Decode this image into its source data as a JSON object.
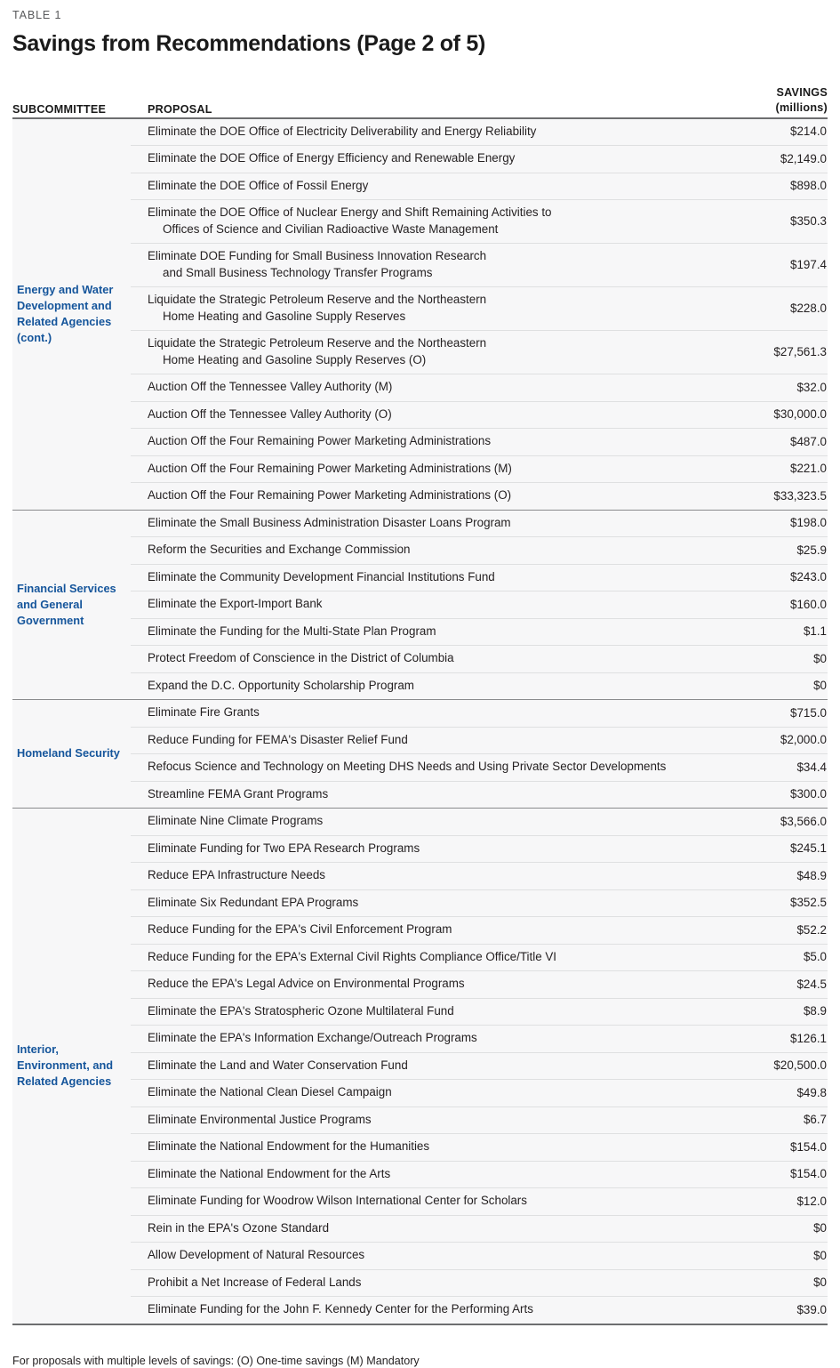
{
  "header": {
    "table_label": "TABLE 1",
    "title": "Savings from Recommendations (Page 2 of 5)"
  },
  "columns": {
    "subcommittee": "SUBCOMMITTEE",
    "proposal": "PROPOSAL",
    "savings_line1": "SAVINGS",
    "savings_line2": "(millions)"
  },
  "colors": {
    "subcommittee_blue": "#15559b",
    "rule_dark": "#6d6e70",
    "rule_light": "#dfe0e1",
    "table_background": "#f7f7f8"
  },
  "footnote": "For proposals with multiple levels of savings:  (O) One-time savings  (M) Mandatory",
  "sections": [
    {
      "subcommittee": "Energy and Water Development and Related Agencies (cont.)",
      "rows": [
        {
          "line1": "Eliminate the DOE Office of Electricity Deliverability and Energy Reliability",
          "line2": "",
          "savings": "$214.0"
        },
        {
          "line1": "Eliminate the DOE Office of Energy Efficiency and Renewable Energy",
          "line2": "",
          "savings": "$2,149.0"
        },
        {
          "line1": "Eliminate the DOE Office of Fossil Energy",
          "line2": "",
          "savings": "$898.0"
        },
        {
          "line1": "Eliminate the DOE Office of Nuclear Energy and Shift Remaining Activities to",
          "line2": "Offices of Science and Civilian Radioactive Waste Management",
          "savings": "$350.3"
        },
        {
          "line1": "Eliminate DOE Funding for Small Business Innovation Research",
          "line2": "and Small Business Technology Transfer Programs",
          "savings": "$197.4"
        },
        {
          "line1": "Liquidate the Strategic Petroleum Reserve and the Northeastern",
          "line2": "Home Heating and Gasoline Supply Reserves",
          "savings": "$228.0"
        },
        {
          "line1": "Liquidate the Strategic Petroleum Reserve and the Northeastern",
          "line2": "Home Heating and Gasoline Supply Reserves (O)",
          "savings": "$27,561.3"
        },
        {
          "line1": "Auction Off the Tennessee Valley Authority (M)",
          "line2": "",
          "savings": "$32.0"
        },
        {
          "line1": "Auction Off the Tennessee Valley Authority (O)",
          "line2": "",
          "savings": "$30,000.0"
        },
        {
          "line1": "Auction Off the Four Remaining Power Marketing Administrations",
          "line2": "",
          "savings": "$487.0"
        },
        {
          "line1": "Auction Off the Four Remaining Power Marketing Administrations (M)",
          "line2": "",
          "savings": "$221.0"
        },
        {
          "line1": "Auction Off the Four Remaining Power Marketing Administrations (O)",
          "line2": "",
          "savings": "$33,323.5"
        }
      ]
    },
    {
      "subcommittee": "Financial Services and General Government",
      "rows": [
        {
          "line1": "Eliminate the Small Business Administration Disaster Loans Program",
          "line2": "",
          "savings": "$198.0"
        },
        {
          "line1": "Reform the Securities and Exchange Commission",
          "line2": "",
          "savings": "$25.9"
        },
        {
          "line1": "Eliminate the Community Development Financial Institutions Fund",
          "line2": "",
          "savings": "$243.0"
        },
        {
          "line1": "Eliminate the Export-Import Bank",
          "line2": "",
          "savings": "$160.0"
        },
        {
          "line1": "Eliminate the Funding for the Multi-State Plan Program",
          "line2": "",
          "savings": "$1.1"
        },
        {
          "line1": "Protect Freedom of Conscience in the District of Columbia",
          "line2": "",
          "savings": "$0"
        },
        {
          "line1": "Expand the D.C. Opportunity Scholarship Program",
          "line2": "",
          "savings": "$0"
        }
      ]
    },
    {
      "subcommittee": "Homeland Security",
      "rows": [
        {
          "line1": "Eliminate Fire Grants",
          "line2": "",
          "savings": "$715.0"
        },
        {
          "line1": "Reduce Funding for FEMA's Disaster Relief Fund",
          "line2": "",
          "savings": "$2,000.0"
        },
        {
          "line1": "Refocus Science and Technology on Meeting DHS Needs and Using Private Sector Developments",
          "line2": "",
          "savings": "$34.4"
        },
        {
          "line1": "Streamline FEMA Grant Programs",
          "line2": "",
          "savings": "$300.0"
        }
      ]
    },
    {
      "subcommittee": "Interior, Environment, and Related Agencies",
      "rows": [
        {
          "line1": "Eliminate Nine Climate Programs",
          "line2": "",
          "savings": "$3,566.0"
        },
        {
          "line1": "Eliminate Funding for Two EPA Research Programs",
          "line2": "",
          "savings": "$245.1"
        },
        {
          "line1": "Reduce EPA Infrastructure Needs",
          "line2": "",
          "savings": "$48.9"
        },
        {
          "line1": "Eliminate Six Redundant EPA Programs",
          "line2": "",
          "savings": "$352.5"
        },
        {
          "line1": "Reduce Funding for the EPA's Civil Enforcement Program",
          "line2": "",
          "savings": "$52.2"
        },
        {
          "line1": "Reduce Funding for the EPA's External Civil Rights Compliance Office/Title VI",
          "line2": "",
          "savings": "$5.0"
        },
        {
          "line1": "Reduce the EPA's Legal Advice on Environmental Programs",
          "line2": "",
          "savings": "$24.5"
        },
        {
          "line1": "Eliminate the EPA's Stratospheric Ozone Multilateral Fund",
          "line2": "",
          "savings": "$8.9"
        },
        {
          "line1": "Eliminate the EPA's Information Exchange/Outreach Programs",
          "line2": "",
          "savings": "$126.1"
        },
        {
          "line1": "Eliminate the Land and Water Conservation Fund",
          "line2": "",
          "savings": "$20,500.0"
        },
        {
          "line1": "Eliminate the National Clean Diesel Campaign",
          "line2": "",
          "savings": "$49.8"
        },
        {
          "line1": "Eliminate Environmental Justice Programs",
          "line2": "",
          "savings": "$6.7"
        },
        {
          "line1": "Eliminate the National Endowment for the Humanities",
          "line2": "",
          "savings": "$154.0"
        },
        {
          "line1": "Eliminate the National Endowment for the Arts",
          "line2": "",
          "savings": "$154.0"
        },
        {
          "line1": "Eliminate Funding for Woodrow Wilson International Center for Scholars",
          "line2": "",
          "savings": "$12.0"
        },
        {
          "line1": "Rein in the EPA's Ozone Standard",
          "line2": "",
          "savings": "$0"
        },
        {
          "line1": "Allow Development of Natural Resources",
          "line2": "",
          "savings": "$0"
        },
        {
          "line1": "Prohibit a Net Increase of Federal Lands",
          "line2": "",
          "savings": "$0"
        },
        {
          "line1": "Eliminate Funding for the John F. Kennedy Center for the Performing Arts",
          "line2": "",
          "savings": "$39.0"
        }
      ]
    }
  ]
}
